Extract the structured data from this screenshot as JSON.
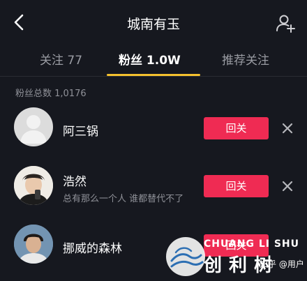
{
  "header": {
    "title": "城南有玉"
  },
  "tabs": [
    {
      "label": "关注 77",
      "active": false
    },
    {
      "label": "粉丝 1.0W",
      "active": true
    },
    {
      "label": "推荐关注",
      "active": false
    }
  ],
  "fans_total": "粉丝总数 1,0176",
  "followers": [
    {
      "name": "阿三锅",
      "bio": "",
      "button": "回关",
      "avatar": "default-avatar"
    },
    {
      "name": "浩然",
      "bio": "总有那么一个人 谁都替代不了",
      "button": "回关",
      "avatar": "photo-avatar"
    },
    {
      "name": "挪威的森林",
      "bio": "",
      "button": "回关",
      "avatar": "photo-avatar"
    }
  ],
  "watermark": {
    "brand_en": "CHUANG LI SHU",
    "brand_cn": "创利树",
    "source": "知乎 @用户"
  },
  "colors": {
    "background": "#16181f",
    "accent_button": "#ef2b53",
    "tab_underline": "#f5c12e"
  }
}
